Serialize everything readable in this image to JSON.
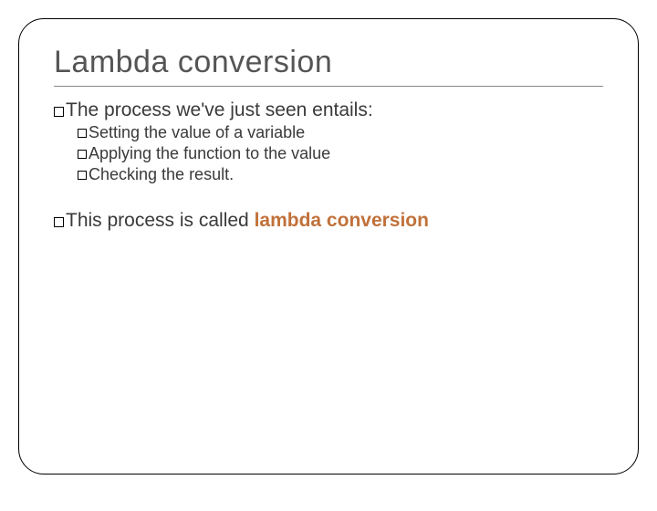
{
  "slide": {
    "title": "Lambda conversion",
    "p1": "The process we've just seen entails:",
    "sub": [
      "Setting the value of a variable",
      "Applying the function to the value",
      "Checking the result."
    ],
    "p2_a": "This process is called ",
    "p2_b": "lambda conversion"
  }
}
